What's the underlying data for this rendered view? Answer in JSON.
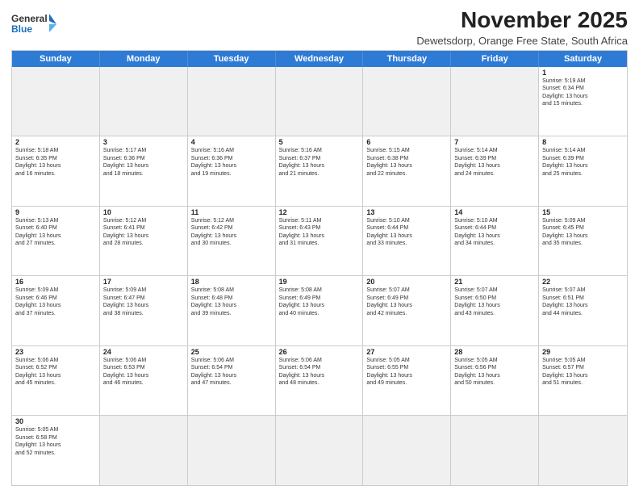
{
  "header": {
    "logo_line1": "General",
    "logo_line2": "Blue",
    "month": "November 2025",
    "location": "Dewetsdorp, Orange Free State, South Africa"
  },
  "weekdays": [
    "Sunday",
    "Monday",
    "Tuesday",
    "Wednesday",
    "Thursday",
    "Friday",
    "Saturday"
  ],
  "weeks": [
    [
      {
        "day": "",
        "info": ""
      },
      {
        "day": "",
        "info": ""
      },
      {
        "day": "",
        "info": ""
      },
      {
        "day": "",
        "info": ""
      },
      {
        "day": "",
        "info": ""
      },
      {
        "day": "",
        "info": ""
      },
      {
        "day": "1",
        "info": "Sunrise: 5:19 AM\nSunset: 6:34 PM\nDaylight: 13 hours\nand 15 minutes."
      }
    ],
    [
      {
        "day": "2",
        "info": "Sunrise: 5:18 AM\nSunset: 6:35 PM\nDaylight: 13 hours\nand 16 minutes."
      },
      {
        "day": "3",
        "info": "Sunrise: 5:17 AM\nSunset: 6:36 PM\nDaylight: 13 hours\nand 18 minutes."
      },
      {
        "day": "4",
        "info": "Sunrise: 5:16 AM\nSunset: 6:36 PM\nDaylight: 13 hours\nand 19 minutes."
      },
      {
        "day": "5",
        "info": "Sunrise: 5:16 AM\nSunset: 6:37 PM\nDaylight: 13 hours\nand 21 minutes."
      },
      {
        "day": "6",
        "info": "Sunrise: 5:15 AM\nSunset: 6:38 PM\nDaylight: 13 hours\nand 22 minutes."
      },
      {
        "day": "7",
        "info": "Sunrise: 5:14 AM\nSunset: 6:39 PM\nDaylight: 13 hours\nand 24 minutes."
      },
      {
        "day": "8",
        "info": "Sunrise: 5:14 AM\nSunset: 6:39 PM\nDaylight: 13 hours\nand 25 minutes."
      }
    ],
    [
      {
        "day": "9",
        "info": "Sunrise: 5:13 AM\nSunset: 6:40 PM\nDaylight: 13 hours\nand 27 minutes."
      },
      {
        "day": "10",
        "info": "Sunrise: 5:12 AM\nSunset: 6:41 PM\nDaylight: 13 hours\nand 28 minutes."
      },
      {
        "day": "11",
        "info": "Sunrise: 5:12 AM\nSunset: 6:42 PM\nDaylight: 13 hours\nand 30 minutes."
      },
      {
        "day": "12",
        "info": "Sunrise: 5:11 AM\nSunset: 6:43 PM\nDaylight: 13 hours\nand 31 minutes."
      },
      {
        "day": "13",
        "info": "Sunrise: 5:10 AM\nSunset: 6:44 PM\nDaylight: 13 hours\nand 33 minutes."
      },
      {
        "day": "14",
        "info": "Sunrise: 5:10 AM\nSunset: 6:44 PM\nDaylight: 13 hours\nand 34 minutes."
      },
      {
        "day": "15",
        "info": "Sunrise: 5:09 AM\nSunset: 6:45 PM\nDaylight: 13 hours\nand 35 minutes."
      }
    ],
    [
      {
        "day": "16",
        "info": "Sunrise: 5:09 AM\nSunset: 6:46 PM\nDaylight: 13 hours\nand 37 minutes."
      },
      {
        "day": "17",
        "info": "Sunrise: 5:09 AM\nSunset: 6:47 PM\nDaylight: 13 hours\nand 38 minutes."
      },
      {
        "day": "18",
        "info": "Sunrise: 5:08 AM\nSunset: 6:48 PM\nDaylight: 13 hours\nand 39 minutes."
      },
      {
        "day": "19",
        "info": "Sunrise: 5:08 AM\nSunset: 6:49 PM\nDaylight: 13 hours\nand 40 minutes."
      },
      {
        "day": "20",
        "info": "Sunrise: 5:07 AM\nSunset: 6:49 PM\nDaylight: 13 hours\nand 42 minutes."
      },
      {
        "day": "21",
        "info": "Sunrise: 5:07 AM\nSunset: 6:50 PM\nDaylight: 13 hours\nand 43 minutes."
      },
      {
        "day": "22",
        "info": "Sunrise: 5:07 AM\nSunset: 6:51 PM\nDaylight: 13 hours\nand 44 minutes."
      }
    ],
    [
      {
        "day": "23",
        "info": "Sunrise: 5:06 AM\nSunset: 6:52 PM\nDaylight: 13 hours\nand 45 minutes."
      },
      {
        "day": "24",
        "info": "Sunrise: 5:06 AM\nSunset: 6:53 PM\nDaylight: 13 hours\nand 46 minutes."
      },
      {
        "day": "25",
        "info": "Sunrise: 5:06 AM\nSunset: 6:54 PM\nDaylight: 13 hours\nand 47 minutes."
      },
      {
        "day": "26",
        "info": "Sunrise: 5:06 AM\nSunset: 6:54 PM\nDaylight: 13 hours\nand 48 minutes."
      },
      {
        "day": "27",
        "info": "Sunrise: 5:05 AM\nSunset: 6:55 PM\nDaylight: 13 hours\nand 49 minutes."
      },
      {
        "day": "28",
        "info": "Sunrise: 5:05 AM\nSunset: 6:56 PM\nDaylight: 13 hours\nand 50 minutes."
      },
      {
        "day": "29",
        "info": "Sunrise: 5:05 AM\nSunset: 6:57 PM\nDaylight: 13 hours\nand 51 minutes."
      }
    ],
    [
      {
        "day": "30",
        "info": "Sunrise: 5:05 AM\nSunset: 6:58 PM\nDaylight: 13 hours\nand 52 minutes."
      },
      {
        "day": "",
        "info": ""
      },
      {
        "day": "",
        "info": ""
      },
      {
        "day": "",
        "info": ""
      },
      {
        "day": "",
        "info": ""
      },
      {
        "day": "",
        "info": ""
      },
      {
        "day": "",
        "info": ""
      }
    ]
  ]
}
